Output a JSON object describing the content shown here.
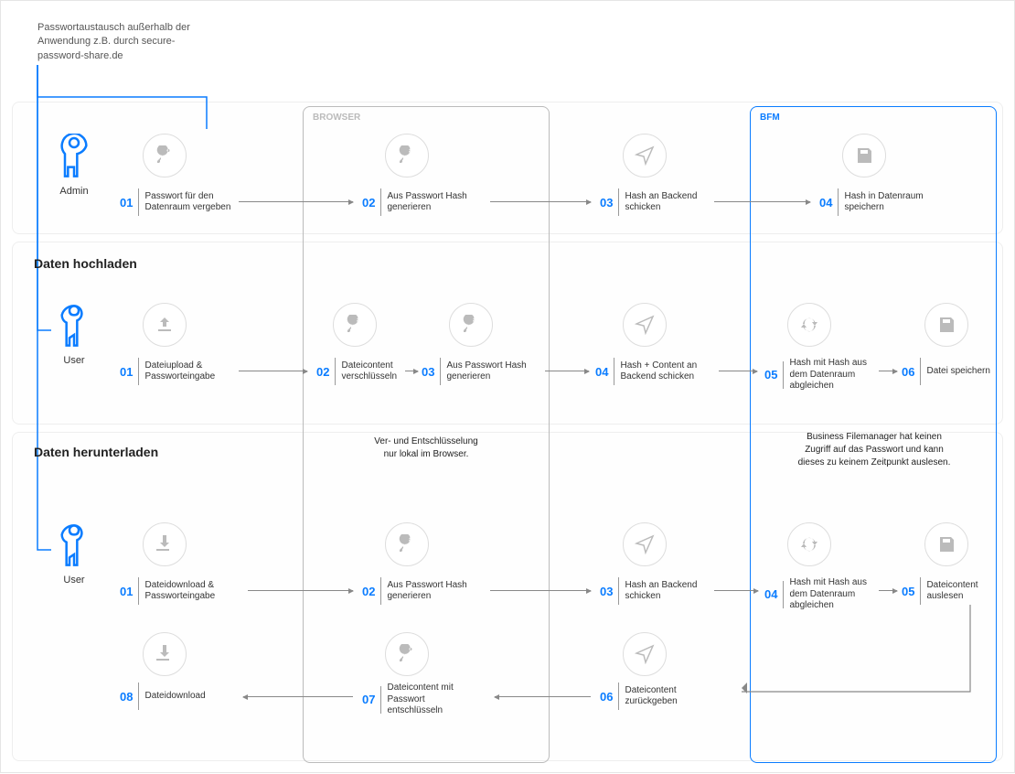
{
  "intro": "Passwortaustausch außerhalb der Anwendung z.B. durch secure-password-share.de",
  "panels": {
    "browser": "BROWSER",
    "bfm": "BFM"
  },
  "actors": {
    "admin": "Admin",
    "user1": "User",
    "user2": "User"
  },
  "sections": {
    "upload": "Daten hochladen",
    "download": "Daten herunterladen"
  },
  "notes": {
    "browser": "Ver- und Entschlüsselung\nnur lokal im Browser.",
    "bfm": "Business Filemanager hat keinen\nZugriff auf das Passwort und kann\ndieses zu keinem Zeitpunkt auslesen."
  },
  "row1": {
    "s1": {
      "n": "01",
      "t": "Passwort für den Datenraum vergeben"
    },
    "s2": {
      "n": "02",
      "t": "Aus Passwort Hash generieren"
    },
    "s3": {
      "n": "03",
      "t": "Hash an Backend schicken"
    },
    "s4": {
      "n": "04",
      "t": "Hash in Datenraum speichern"
    }
  },
  "row2": {
    "s1": {
      "n": "01",
      "t": "Dateiupload & Passworteingabe"
    },
    "s2": {
      "n": "02",
      "t": "Dateicontent verschlüsseln"
    },
    "s3": {
      "n": "03",
      "t": "Aus Passwort Hash generieren"
    },
    "s4": {
      "n": "04",
      "t": "Hash + Content an Backend schicken"
    },
    "s5": {
      "n": "05",
      "t": "Hash mit Hash aus dem Datenraum abgleichen"
    },
    "s6": {
      "n": "06",
      "t": "Datei speichern"
    }
  },
  "row3": {
    "s1": {
      "n": "01",
      "t": "Dateidownload & Passworteingabe"
    },
    "s2": {
      "n": "02",
      "t": "Aus Passwort Hash generieren"
    },
    "s3": {
      "n": "03",
      "t": "Hash an Backend schicken"
    },
    "s4": {
      "n": "04",
      "t": "Hash mit Hash aus dem Datenraum abgleichen"
    },
    "s5": {
      "n": "05",
      "t": "Dateicontent auslesen"
    },
    "s6": {
      "n": "06",
      "t": "Dateicontent zurückgeben"
    },
    "s7": {
      "n": "07",
      "t": "Dateicontent mit Passwort entschlüsseln"
    },
    "s8": {
      "n": "08",
      "t": "Dateidownload"
    }
  },
  "colors": {
    "accent": "#0a7cff",
    "gray": "#888"
  }
}
